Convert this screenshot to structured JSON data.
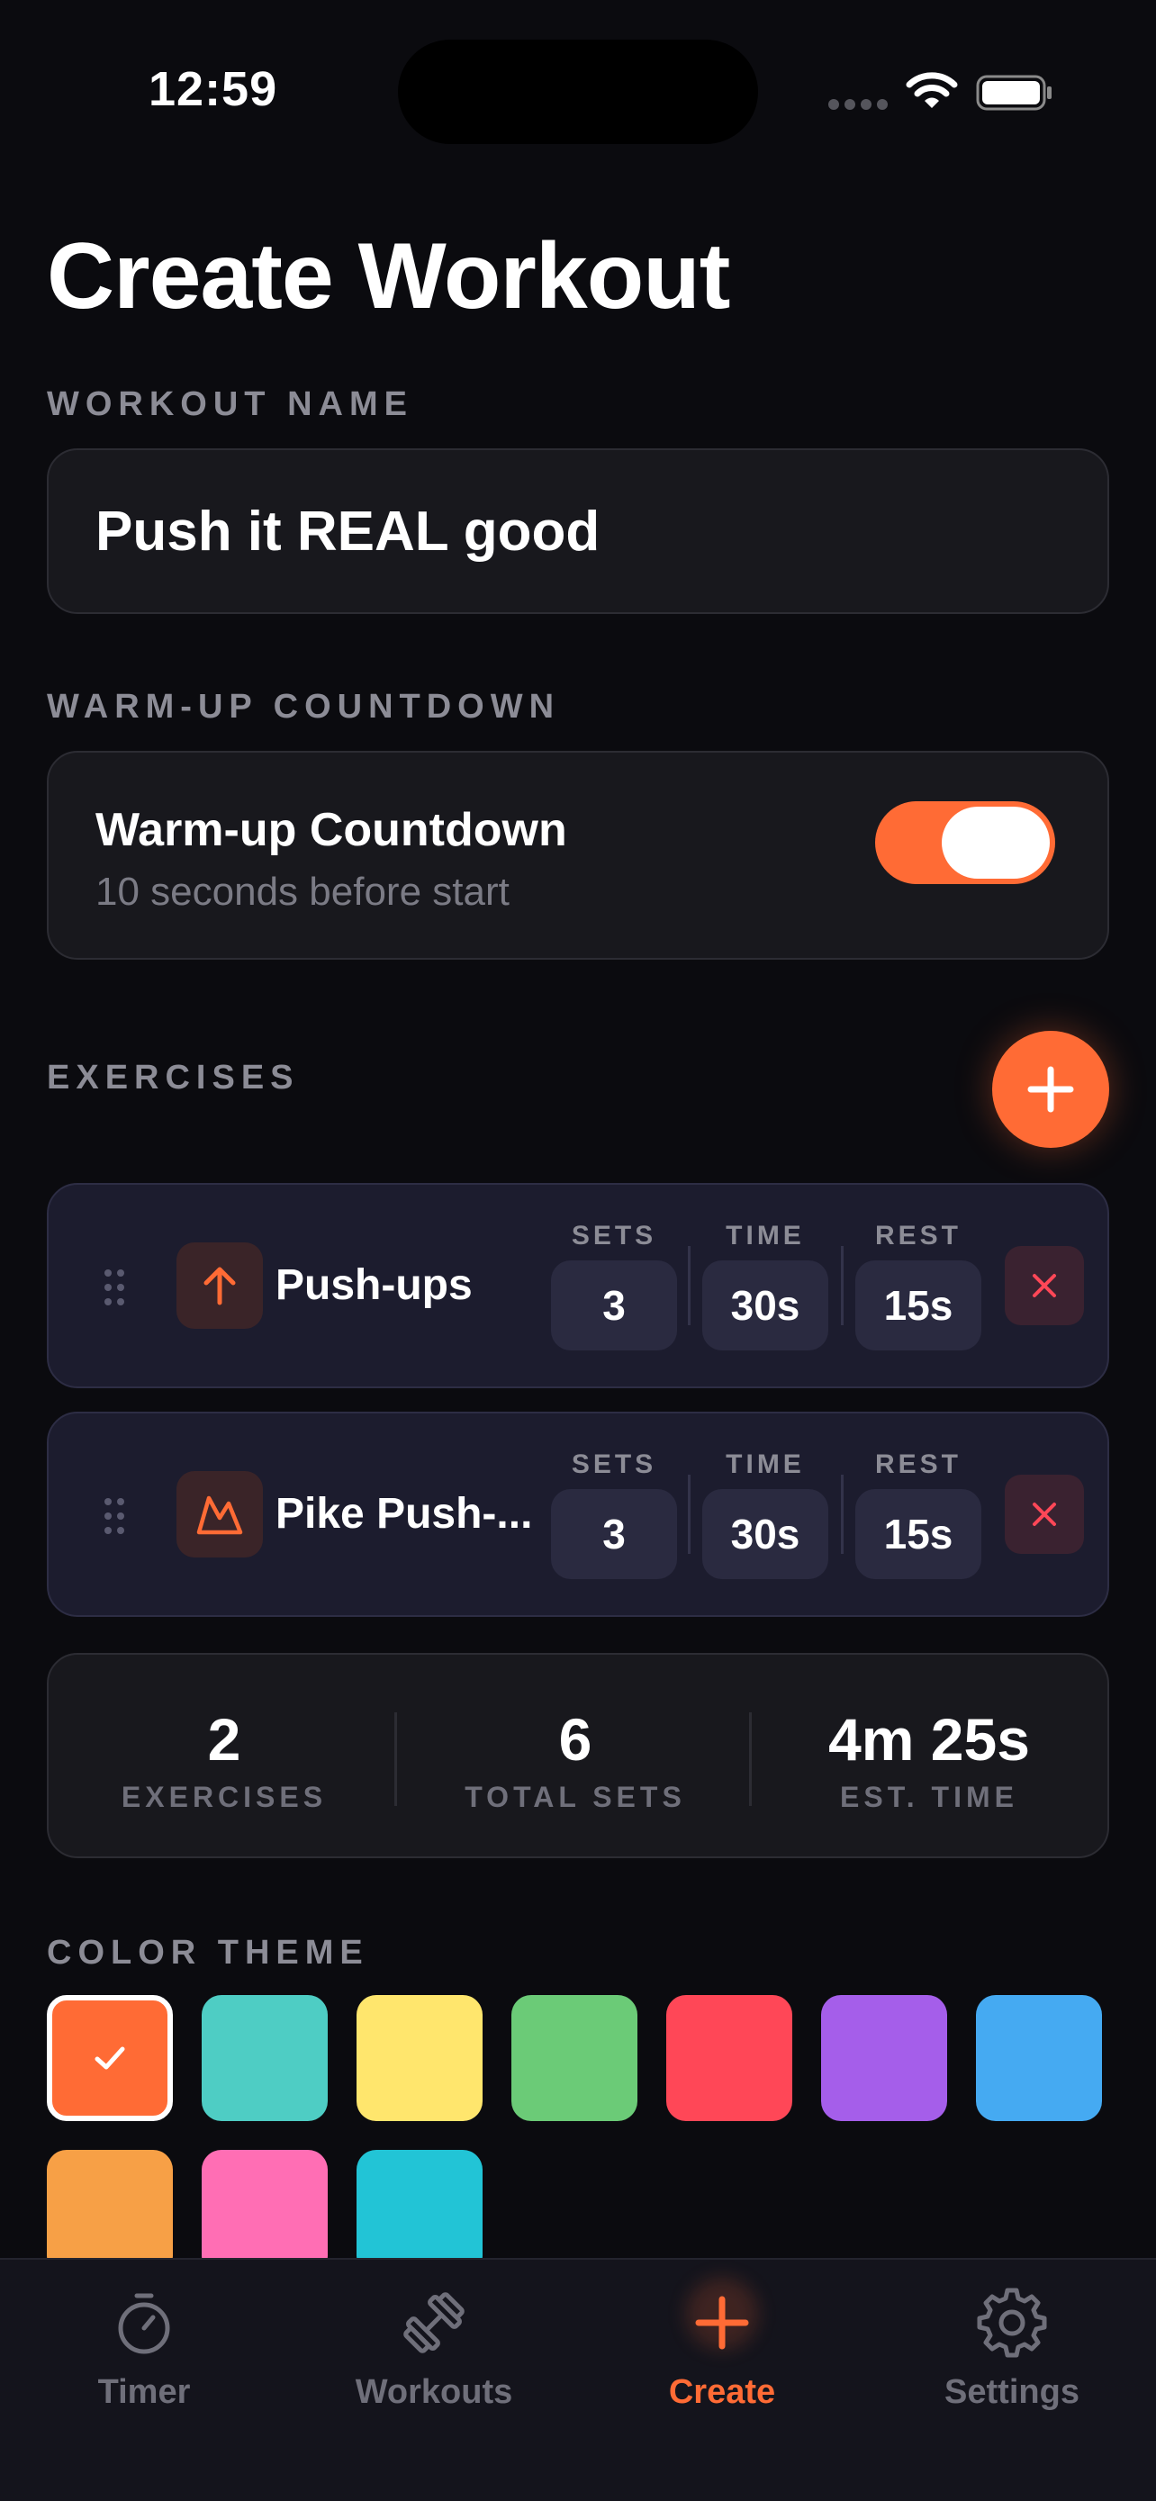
{
  "status_bar": {
    "time": "12:59"
  },
  "page": {
    "title": "Create Workout"
  },
  "workout_name": {
    "section_label": "WORKOUT NAME",
    "value": "Push it REAL good"
  },
  "warmup": {
    "section_label": "WARM-UP COUNTDOWN",
    "title": "Warm-up Countdown",
    "subtitle": "10 seconds before start",
    "enabled": true
  },
  "exercises": {
    "section_label": "EXERCISES",
    "add_icon": "plus-icon",
    "headers": {
      "sets": "SETS",
      "time": "TIME",
      "rest": "REST"
    },
    "items": [
      {
        "name": "Push-ups",
        "icon": "arrow-up-icon",
        "sets": "3",
        "time": "30s",
        "rest": "15s"
      },
      {
        "name": "Pike Push-...",
        "icon": "mountain-icon",
        "sets": "3",
        "time": "30s",
        "rest": "15s"
      }
    ]
  },
  "summary": {
    "exercises_value": "2",
    "exercises_label": "EXERCISES",
    "sets_value": "6",
    "sets_label": "TOTAL SETS",
    "time_value": "4m 25s",
    "time_label": "EST. TIME"
  },
  "color_theme": {
    "section_label": "COLOR THEME",
    "colors": [
      "#ff6b35",
      "#4ecdc4",
      "#ffe66d",
      "#6bcb77",
      "#ff4757",
      "#a55eea",
      "#45aaf2",
      "#f7a046",
      "#ff6eb4",
      "#22c4d6"
    ],
    "selected": "#ff6b35"
  },
  "tabbar": {
    "tabs": [
      {
        "label": "Timer",
        "icon": "stopwatch-icon"
      },
      {
        "label": "Workouts",
        "icon": "dumbbell-icon"
      },
      {
        "label": "Create",
        "icon": "plus-icon"
      },
      {
        "label": "Settings",
        "icon": "gear-icon"
      }
    ],
    "active": "Create"
  },
  "colors": {
    "accent": "#ff6b35",
    "background": "#0b0b0f",
    "card": "#18181d",
    "exercise_card": "#1c1c2e",
    "danger": "#ff4757"
  }
}
